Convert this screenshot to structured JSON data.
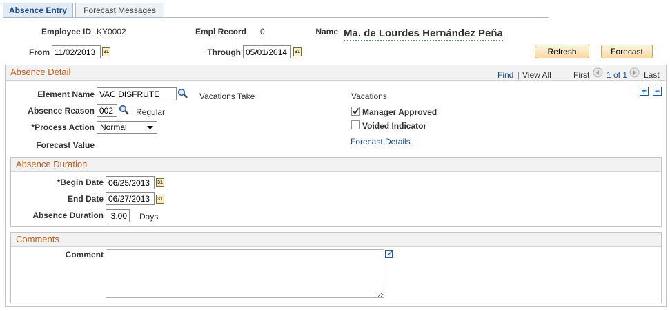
{
  "tabs": [
    {
      "label": "Absence Entry",
      "active": true
    },
    {
      "label": "Forecast Messages",
      "active": false
    }
  ],
  "header": {
    "employee_id_label": "Employee ID",
    "employee_id": "KY0002",
    "empl_record_label": "Empl Record",
    "empl_record": "0",
    "name_label": "Name",
    "name": "Ma. de Lourdes Hernández Peña",
    "from_label": "From",
    "from_date": "11/02/2013",
    "through_label": "Through",
    "through_date": "05/01/2014",
    "refresh_label": "Refresh",
    "forecast_label": "Forecast"
  },
  "absence_detail": {
    "title": "Absence Detail",
    "find_label": "Find",
    "separator": "|",
    "view_all_label": "View All",
    "first_label": "First",
    "pager_text": "1 of 1",
    "last_label": "Last",
    "element_name_label": "Element Name",
    "element_name": "VAC DISFRUTE",
    "element_desc": "Vacations Take",
    "element_category": "Vacations",
    "absence_reason_label": "Absence Reason",
    "absence_reason": "002",
    "absence_reason_desc": "Regular",
    "process_action_label": "*Process Action",
    "process_action": "Normal",
    "forecast_value_label": "Forecast Value",
    "manager_approved_label": "Manager Approved",
    "manager_approved": true,
    "voided_indicator_label": "Voided Indicator",
    "voided_indicator": false,
    "forecast_details_link": "Forecast Details"
  },
  "absence_duration": {
    "title": "Absence Duration",
    "begin_date_label": "*Begin Date",
    "begin_date": "06/25/2013",
    "end_date_label": "End Date",
    "end_date": "06/27/2013",
    "duration_label": "Absence Duration",
    "duration": "3.00",
    "duration_unit": "Days"
  },
  "comments": {
    "title": "Comments",
    "comment_label": "Comment",
    "comment": ""
  },
  "icons": {
    "calendar": "calendar-icon",
    "lookup": "magnifier-icon",
    "add_row": "plus-icon",
    "delete_row": "minus-icon",
    "expand": "expand-icon"
  },
  "colors": {
    "section_title": "#bd5d1d",
    "link": "#124e8c",
    "button_fill": "#f8d9a0"
  }
}
